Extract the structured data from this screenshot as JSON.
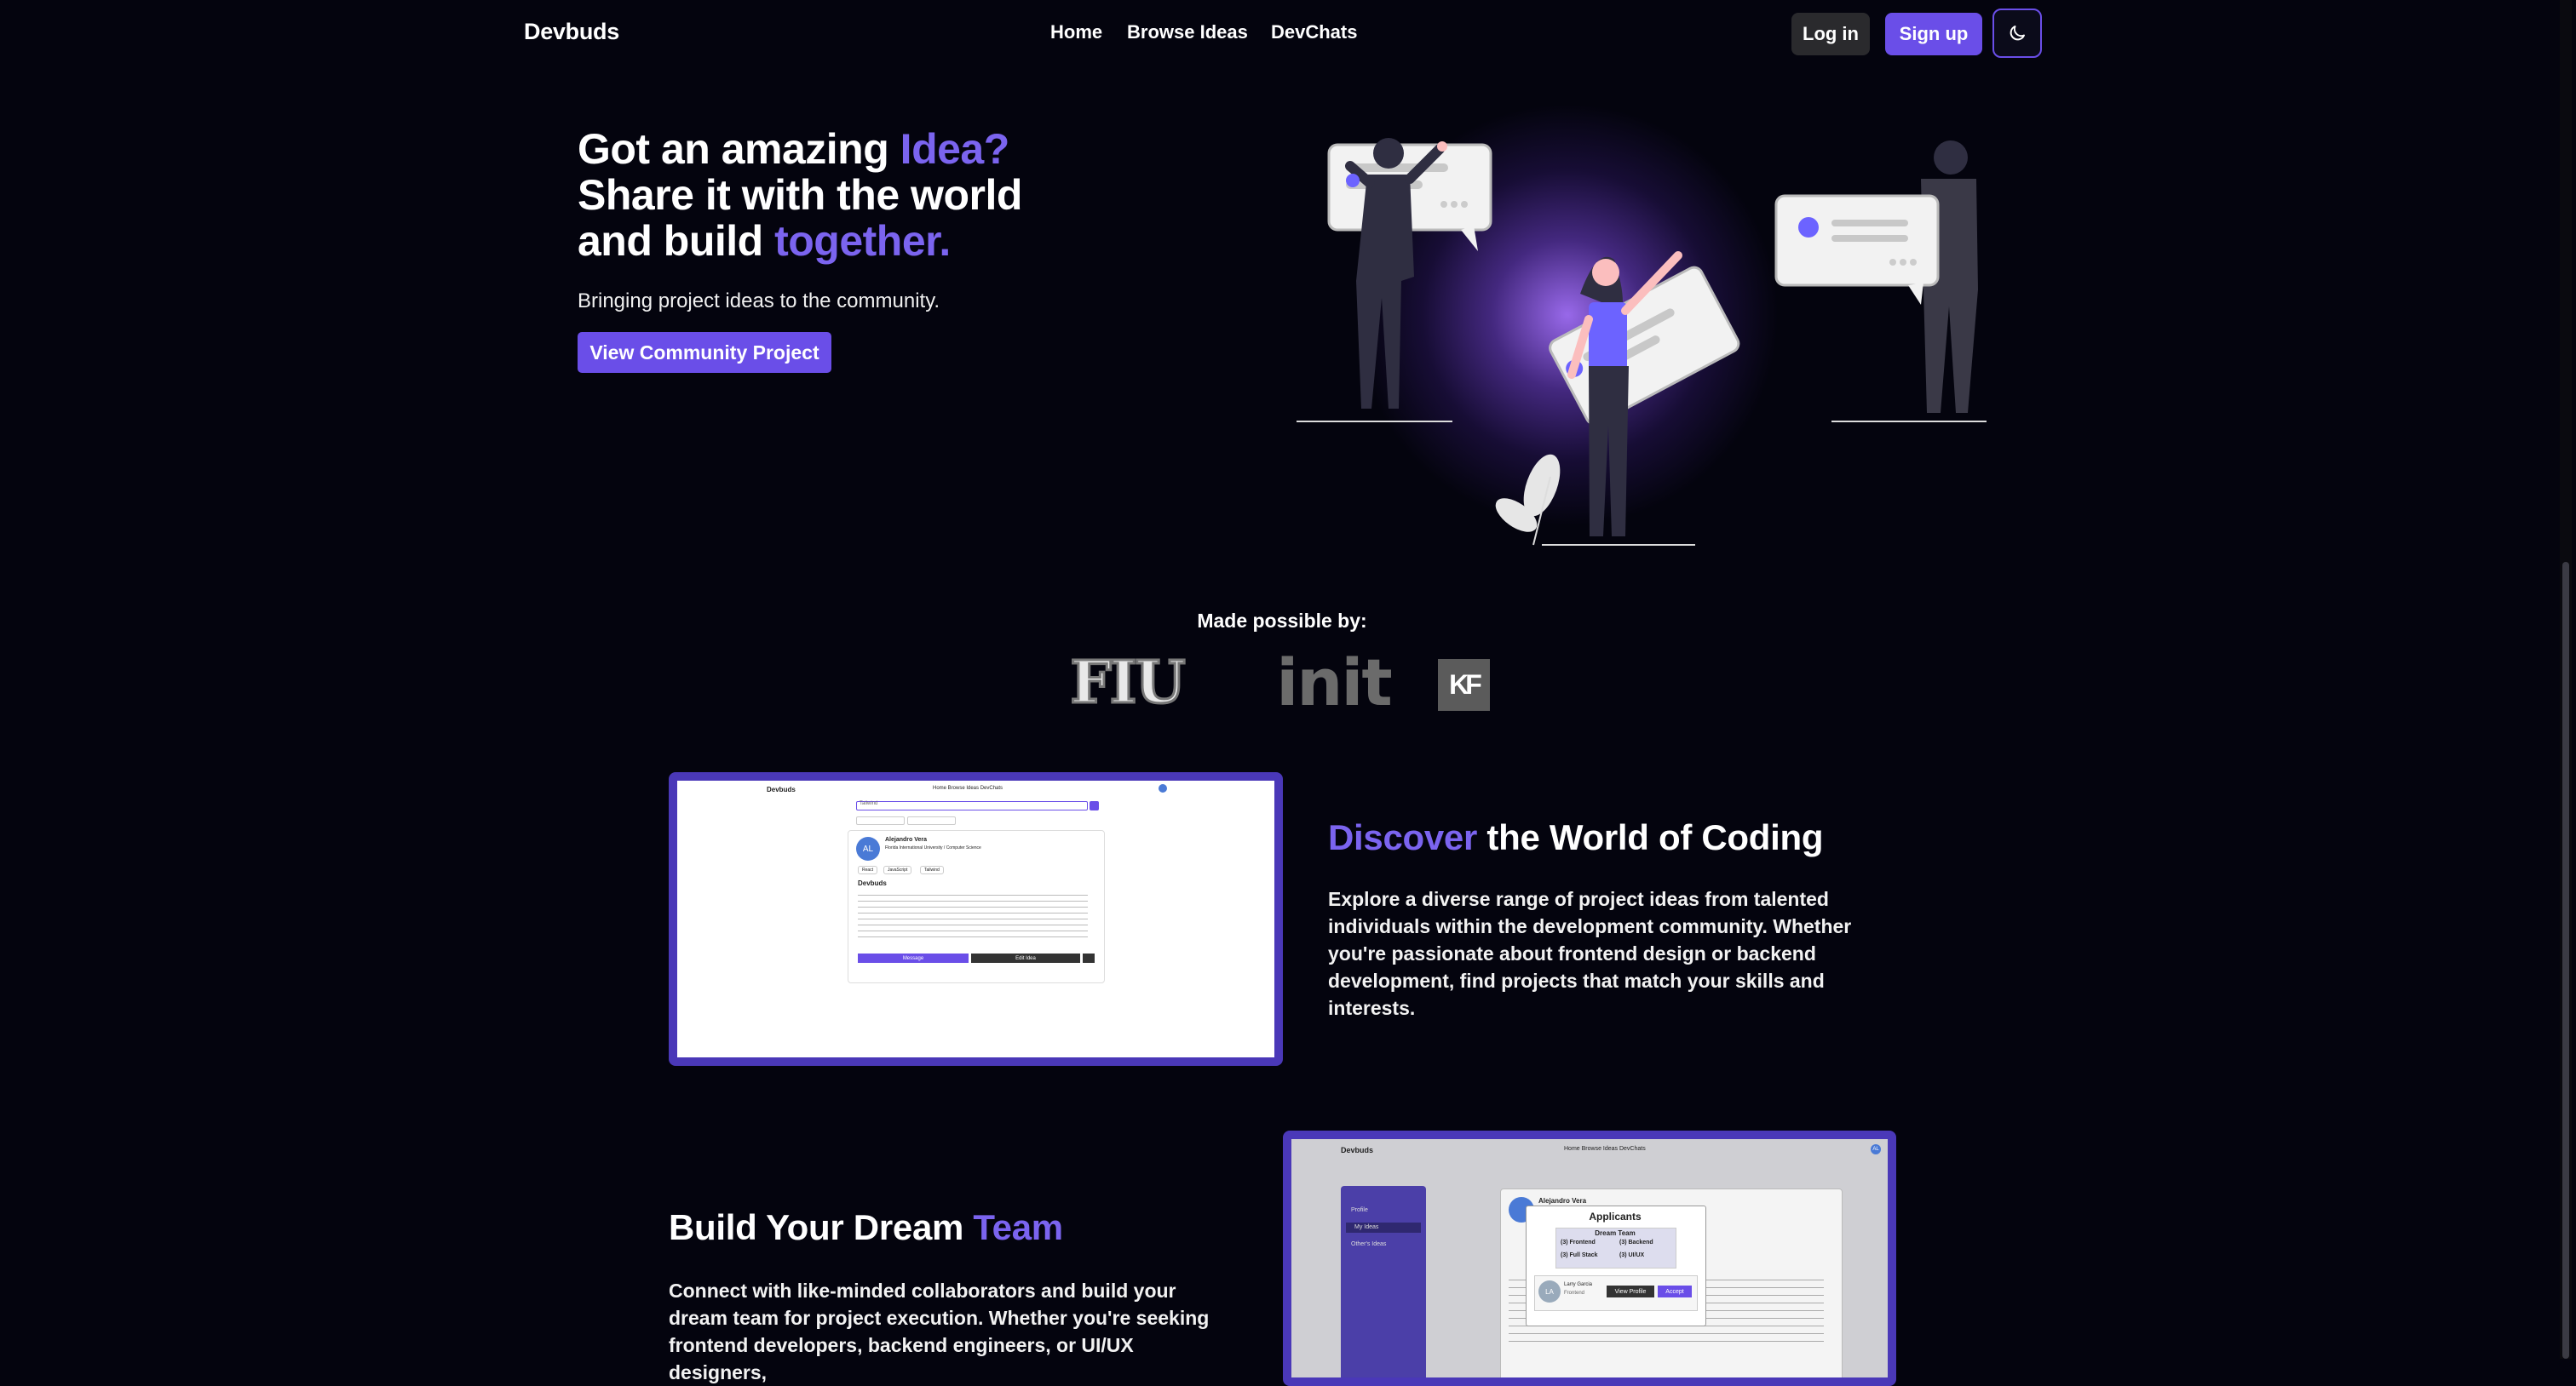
{
  "nav": {
    "brand": "Devbuds",
    "links": [
      "Home",
      "Browse Ideas",
      "DevChats"
    ],
    "login": "Log in",
    "signup": "Sign up",
    "theme_icon": "moon-icon"
  },
  "hero": {
    "title_1": "Got an amazing ",
    "title_1_accent": "Idea?",
    "title_2": "Share it with the world",
    "title_3": "and build ",
    "title_3_accent": "together.",
    "subtitle": "Bringing project ideas to the community.",
    "cta": "View Community Project"
  },
  "sponsors": {
    "heading": "Made possible by:",
    "logos": [
      "FIU",
      "init",
      "KF"
    ]
  },
  "discover": {
    "title_accent": "Discover",
    "title_rest": " the World of Coding",
    "body": "Explore a diverse range of project ideas from talented individuals within the development community. Whether you're passionate about frontend design or backend development, find projects that match your skills and interests."
  },
  "team": {
    "title_main": "Build Your Dream ",
    "title_accent": "Team",
    "body": "Connect with like-minded collaborators and build your dream team for project execution. Whether you're seeking frontend developers, backend engineers, or UI/UX designers,"
  },
  "shot1": {
    "brand": "Devbuds",
    "links": "Home   Browse Ideas   DevChats",
    "search": "Tailwind",
    "avatar": "AL",
    "name": "Alejandro Vera",
    "school": "Florida International University / Computer Science",
    "tags": [
      "React",
      "JavaScript",
      "Tailwind"
    ],
    "project": "Devbuds",
    "message": "Message",
    "edit": "Edit Idea"
  },
  "shot2": {
    "brand": "Devbuds",
    "links": "Home   Browse Ideas   DevChats",
    "side": [
      "Profile",
      "My Ideas",
      "Other's Ideas"
    ],
    "name": "Alejandro Vera",
    "modal_title": "Applicants",
    "team": "Dream Team",
    "roles": [
      "(3) Frontend",
      "(3) Backend",
      "(3) Full Stack",
      "(3) UI/UX"
    ],
    "applicant": "Larry Garcia",
    "applicant_role": "Frontend",
    "applicant_avatar": "LA",
    "view_profile": "View Profile",
    "accept": "Accept",
    "avatar": "AL"
  },
  "colors": {
    "accent": "#7b64ef",
    "button": "#6a4ee8",
    "bg": "#04040e"
  }
}
